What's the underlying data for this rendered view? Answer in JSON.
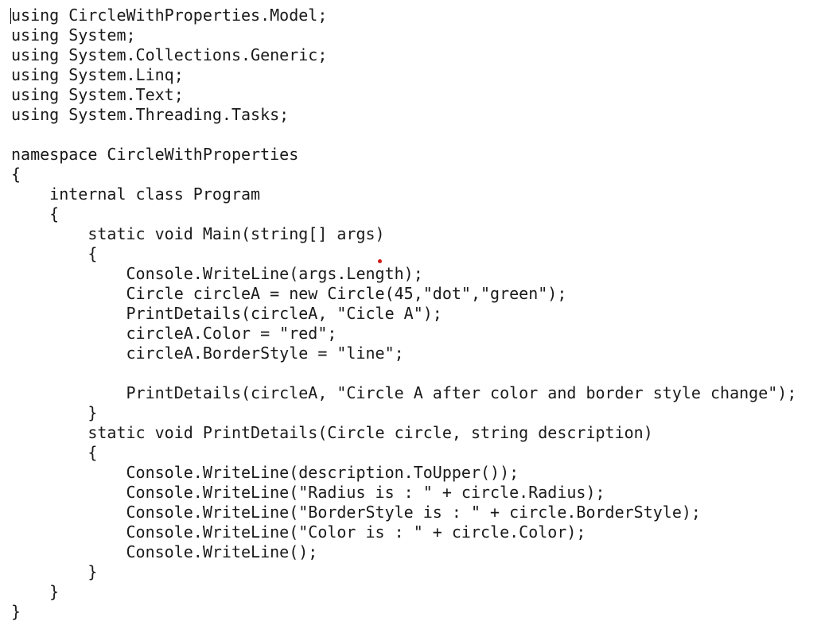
{
  "code": {
    "lines": [
      "using CircleWithProperties.Model;",
      "using System;",
      "using System.Collections.Generic;",
      "using System.Linq;",
      "using System.Text;",
      "using System.Threading.Tasks;",
      "",
      "namespace CircleWithProperties",
      "{",
      "    internal class Program",
      "    {",
      "        static void Main(string[] args)",
      "        {",
      "            Console.WriteLine(args.Length);",
      "            Circle circleA = new Circle(45,\"dot\",\"green\");",
      "            PrintDetails(circleA, \"Cicle A\");",
      "            circleA.Color = \"red\";",
      "            circleA.BorderStyle = \"line\";",
      "",
      "            PrintDetails(circleA, \"Circle A after color and border style change\");",
      "        }",
      "        static void PrintDetails(Circle circle, string description)",
      "        {",
      "            Console.WriteLine(description.ToUpper());",
      "            Console.WriteLine(\"Radius is : \" + circle.Radius);",
      "            Console.WriteLine(\"BorderStyle is : \" + circle.BorderStyle);",
      "            Console.WriteLine(\"Color is : \" + circle.Color);",
      "            Console.WriteLine();",
      "        }",
      "    }",
      "}"
    ]
  },
  "colors": {
    "text": "#1a1a1a",
    "background": "#ffffff",
    "marker": "#d11a1a"
  }
}
